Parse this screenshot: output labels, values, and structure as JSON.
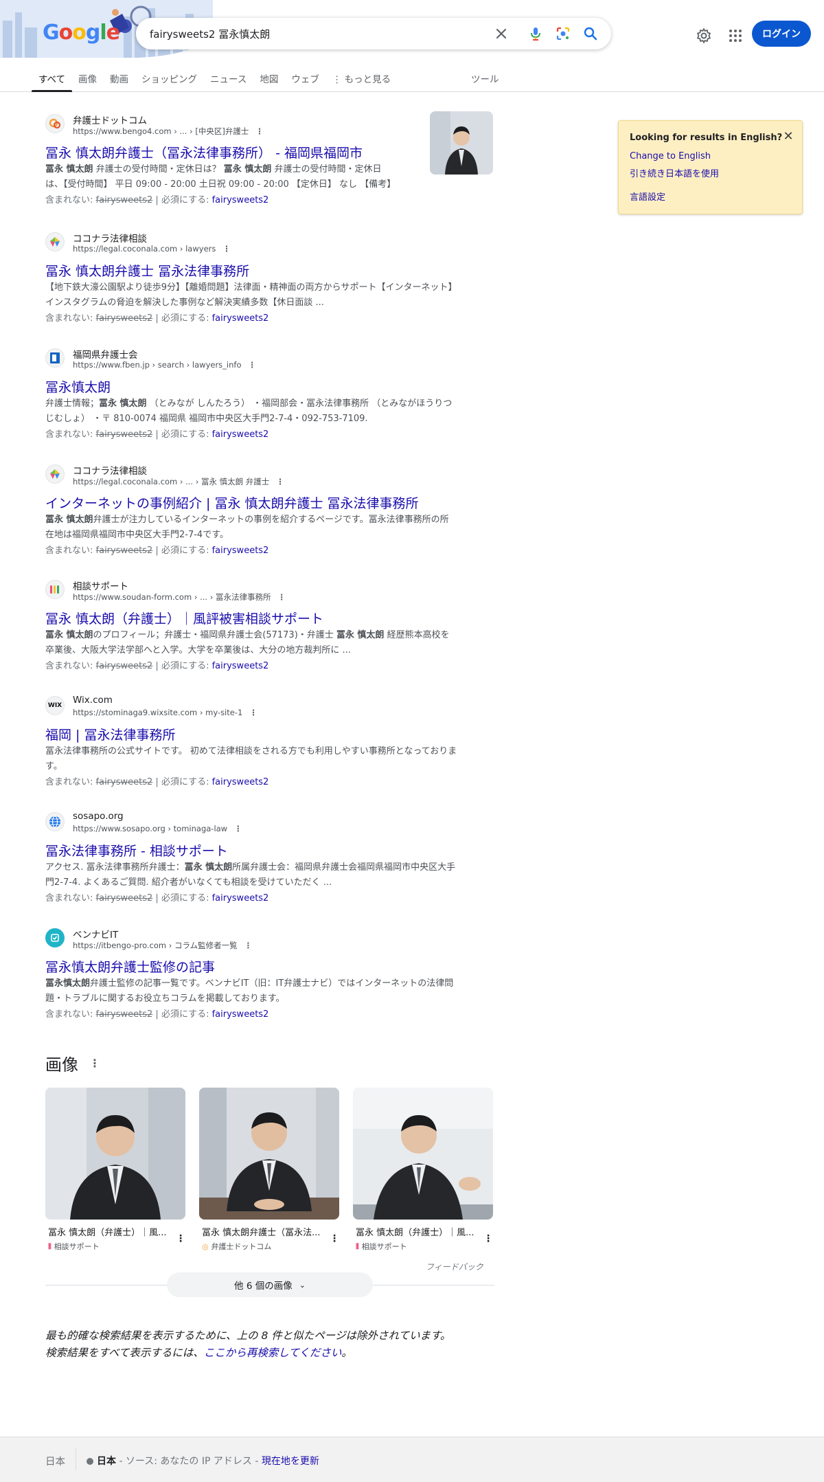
{
  "header": {
    "logo_text": "Google",
    "search_value": "fairysweets2 冨永慎太朗",
    "login_label": "ログイン"
  },
  "tabs": [
    {
      "label": "すべて",
      "active": true
    },
    {
      "label": "画像"
    },
    {
      "label": "動画"
    },
    {
      "label": "ショッピング"
    },
    {
      "label": "ニュース"
    },
    {
      "label": "地図"
    },
    {
      "label": "ウェブ"
    },
    {
      "label": "⋮ もっと見る"
    }
  ],
  "tools_label": "ツール",
  "results": [
    {
      "site": "弁護士ドットコム",
      "url": "https://www.bengo4.com › ... › [中央区]弁護士",
      "title": "冨永 慎太朗弁護士（冨永法律事務所） - 福岡県福岡市",
      "snippet": "冨永 慎太朗 弁護士の受付時間・定休日は？ 冨永 慎太朗 弁護士の受付時間・定休日は、【受付時間】 平日 09:00 - 20:00 土日祝 09:00 - 20:00 【定休日】 なし 【備考】",
      "missing": "fairysweets2",
      "favicon_icon": "bengo4-icon"
    },
    {
      "site": "ココナラ法律相談",
      "url": "https://legal.coconala.com › lawyers",
      "title": "冨永 慎太朗弁護士 冨永法律事務所",
      "snippet": "【地下鉄大濠公園駅より徒歩9分】【離婚問題】法律面・精神面の両方からサポート【インターネット】インスタグラムの脅迫を解決した事例など解決実績多数【休日面談 ...",
      "missing": "fairysweets2",
      "favicon_icon": "coconala-icon"
    },
    {
      "site": "福岡県弁護士会",
      "url": "https://www.fben.jp › search › lawyers_info",
      "title": "冨永慎太朗",
      "snippet": "弁護士情報；冨永 慎太朗 （とみなが しんたろう） ・福岡部会・冨永法律事務所 （とみながほうりつじむしょ） ・〒 810-0074 福岡県 福岡市中央区大手門2-7-4・092-753-7109.",
      "missing": "fairysweets2",
      "favicon_icon": "fben-icon"
    },
    {
      "site": "ココナラ法律相談",
      "url": "https://legal.coconala.com › ... › 冨永 慎太朗 弁護士",
      "title": "インターネットの事例紹介 | 冨永 慎太朗弁護士 冨永法律事務所",
      "snippet": "冨永 慎太朗弁護士が注力しているインターネットの事例を紹介するページです。冨永法律事務所の所在地は福岡県福岡市中央区大手門2-7-4です。",
      "missing": "fairysweets2",
      "favicon_icon": "coconala-icon"
    },
    {
      "site": "相談サポート",
      "url": "https://www.soudan-form.com › ... › 冨永法律事務所",
      "title": "冨永 慎太朗（弁護士）｜風評被害相談サポート",
      "snippet": "冨永 慎太朗のプロフィール；弁護士・福岡県弁護士会(57173)・弁護士 冨永 慎太朗 経歴熊本高校を卒業後、大阪大学法学部へと入学。大学を卒業後は、大分の地方裁判所に ...",
      "missing": "fairysweets2",
      "favicon_icon": "soudan-icon"
    },
    {
      "site": "Wix.com",
      "url": "https://stominaga9.wixsite.com › my-site-1",
      "title": "福岡 | 冨永法律事務所",
      "snippet": "冨永法律事務所の公式サイトです。 初めて法律相談をされる方でも利用しやすい事務所となっております。",
      "missing": "fairysweets2",
      "favicon_icon": "wix-icon"
    },
    {
      "site": "sosapo.org",
      "url": "https://www.sosapo.org › tominaga-law",
      "title": "冨永法律事務所 - 相談サポート",
      "snippet": "アクセス. 冨永法律事務所弁護士：冨永 慎太朗所属弁護士会：福岡県弁護士会福岡県福岡市中央区大手門2-7-4. よくあるご質問. 紹介者がいなくても相談を受けていただく ...",
      "missing": "fairysweets2",
      "favicon_icon": "globe-icon"
    },
    {
      "site": "ベンナビIT",
      "url": "https://itbengo-pro.com › コラム監修者一覧",
      "title": "冨永慎太朗弁護士監修の記事",
      "snippet": "冨永慎太朗弁護士監修の記事一覧です。ベンナビIT（旧：IT弁護士ナビ）ではインターネットの法律問題・トラブルに関するお役立ちコラムを掲載しております。",
      "missing": "fairysweets2",
      "favicon_icon": "bennavi-icon"
    }
  ],
  "missing_label": "含まれない:",
  "required_label": "必須にする:",
  "english_box": {
    "heading": "Looking for results in English?",
    "link1": "Change to English",
    "link2": "引き続き日本語を使用",
    "link3": "言語設定"
  },
  "images": {
    "title": "画像",
    "cards": [
      {
        "caption": "冨永 慎太朗（弁護士）｜風...",
        "source": "相談サポート"
      },
      {
        "caption": "冨永 慎太朗弁護士（冨永法...",
        "source": "弁護士ドットコム"
      },
      {
        "caption": "冨永 慎太朗（弁護士）｜風...",
        "source": "相談サポート"
      }
    ],
    "feedback": "フィードバック",
    "more_button": "他 6 個の画像"
  },
  "omitted": {
    "line1": "最も的確な検索結果を表示するために、上の 8 件と似たページは除外されています。",
    "line2_prefix": "検索結果をすべて表示するには、",
    "line2_link": "ここから再検索してください",
    "line2_suffix": "。"
  },
  "footer": {
    "country": "日本",
    "location_bold": "日本",
    "source_text": " - ソース: あなたの IP アドレス - ",
    "update_link": "現在地を更新"
  },
  "colors": {
    "link": "#1a0dab",
    "login_bg": "#0b57d0",
    "notice_bg": "#feefc3"
  }
}
